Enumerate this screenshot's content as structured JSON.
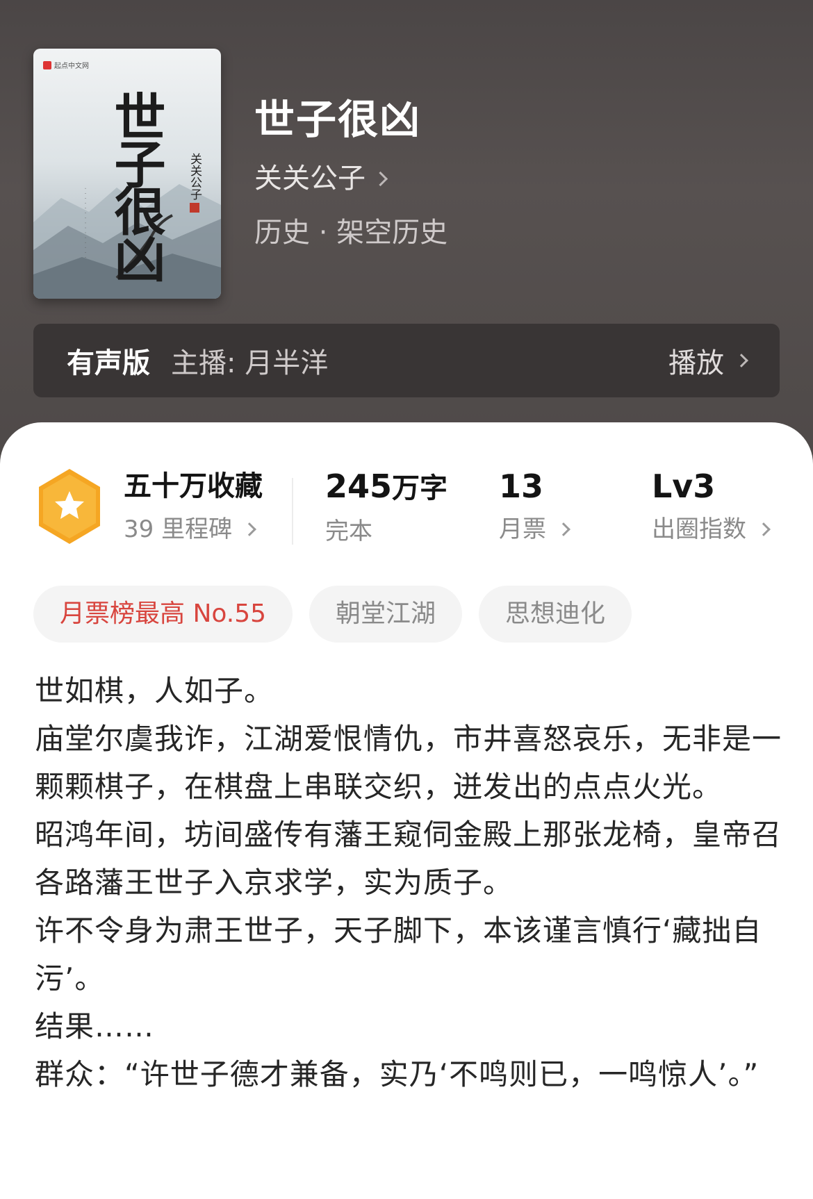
{
  "book": {
    "cover": {
      "publisher_mark": "起点中文网",
      "title": "世子很凶",
      "author": "关关公子"
    },
    "title": "世子很凶",
    "author": "关关公子",
    "genre": "历史 · 架空历史"
  },
  "audio": {
    "label": "有声版",
    "host": "主播:  月半洋",
    "play_label": "播放"
  },
  "stats": {
    "badge": {
      "value": "五十万收藏",
      "sub": "39 里程碑"
    },
    "words": {
      "value": "245",
      "unit": "万字",
      "sub": "完本"
    },
    "tickets": {
      "value": "13",
      "sub": "月票"
    },
    "level": {
      "value": "Lv3",
      "sub": "出圈指数"
    }
  },
  "tags": [
    "月票榜最高 No.55",
    "朝堂江湖",
    "思想迪化"
  ],
  "description": [
    "世如棋，人如子。",
    "庙堂尔虞我诈，江湖爱恨情仇，市井喜怒哀乐，无非是一颗颗棋子，在棋盘上串联交织，迸发出的点点火光。",
    "昭鸿年间，坊间盛传有藩王窥伺金殿上那张龙椅，皇帝召各路藩王世子入京求学，实为质子。",
    "许不令身为肃王世子，天子脚下，本该谨言慎行‘藏拙自污’。",
    "结果……",
    "群众：“许世子德才兼备，实乃‘不鸣则已，一鸣惊人’。”"
  ],
  "colors": {
    "hero_bg": "#524c4b",
    "audio_bg": "#393535",
    "accent_red": "#d8453e",
    "badge_orange": "#f5a623"
  }
}
